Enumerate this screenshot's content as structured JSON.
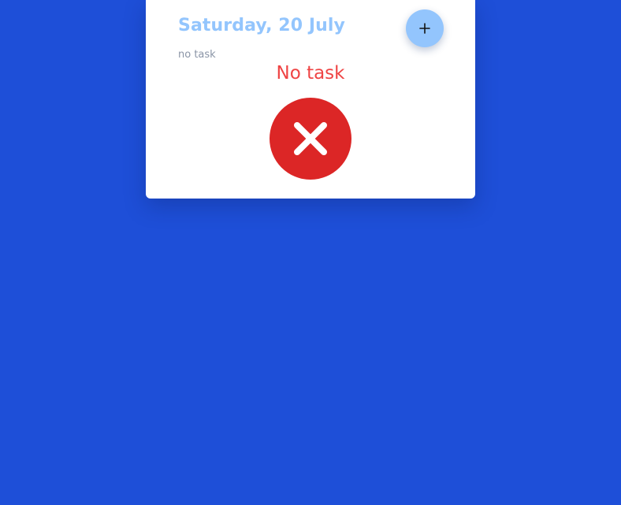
{
  "header": {
    "date": "Saturday, 20 July",
    "task_count_text": "no task"
  },
  "add_button": {
    "icon": "plus-icon",
    "label": ""
  },
  "empty_state": {
    "message": "No task",
    "icon": "close-circle-icon"
  },
  "colors": {
    "background": "#1e4fd8",
    "card": "#ffffff",
    "accent_light_blue": "#93c5fd",
    "danger": "#dc2626",
    "danger_text": "#ef4444",
    "muted_text": "#8a94a6"
  }
}
